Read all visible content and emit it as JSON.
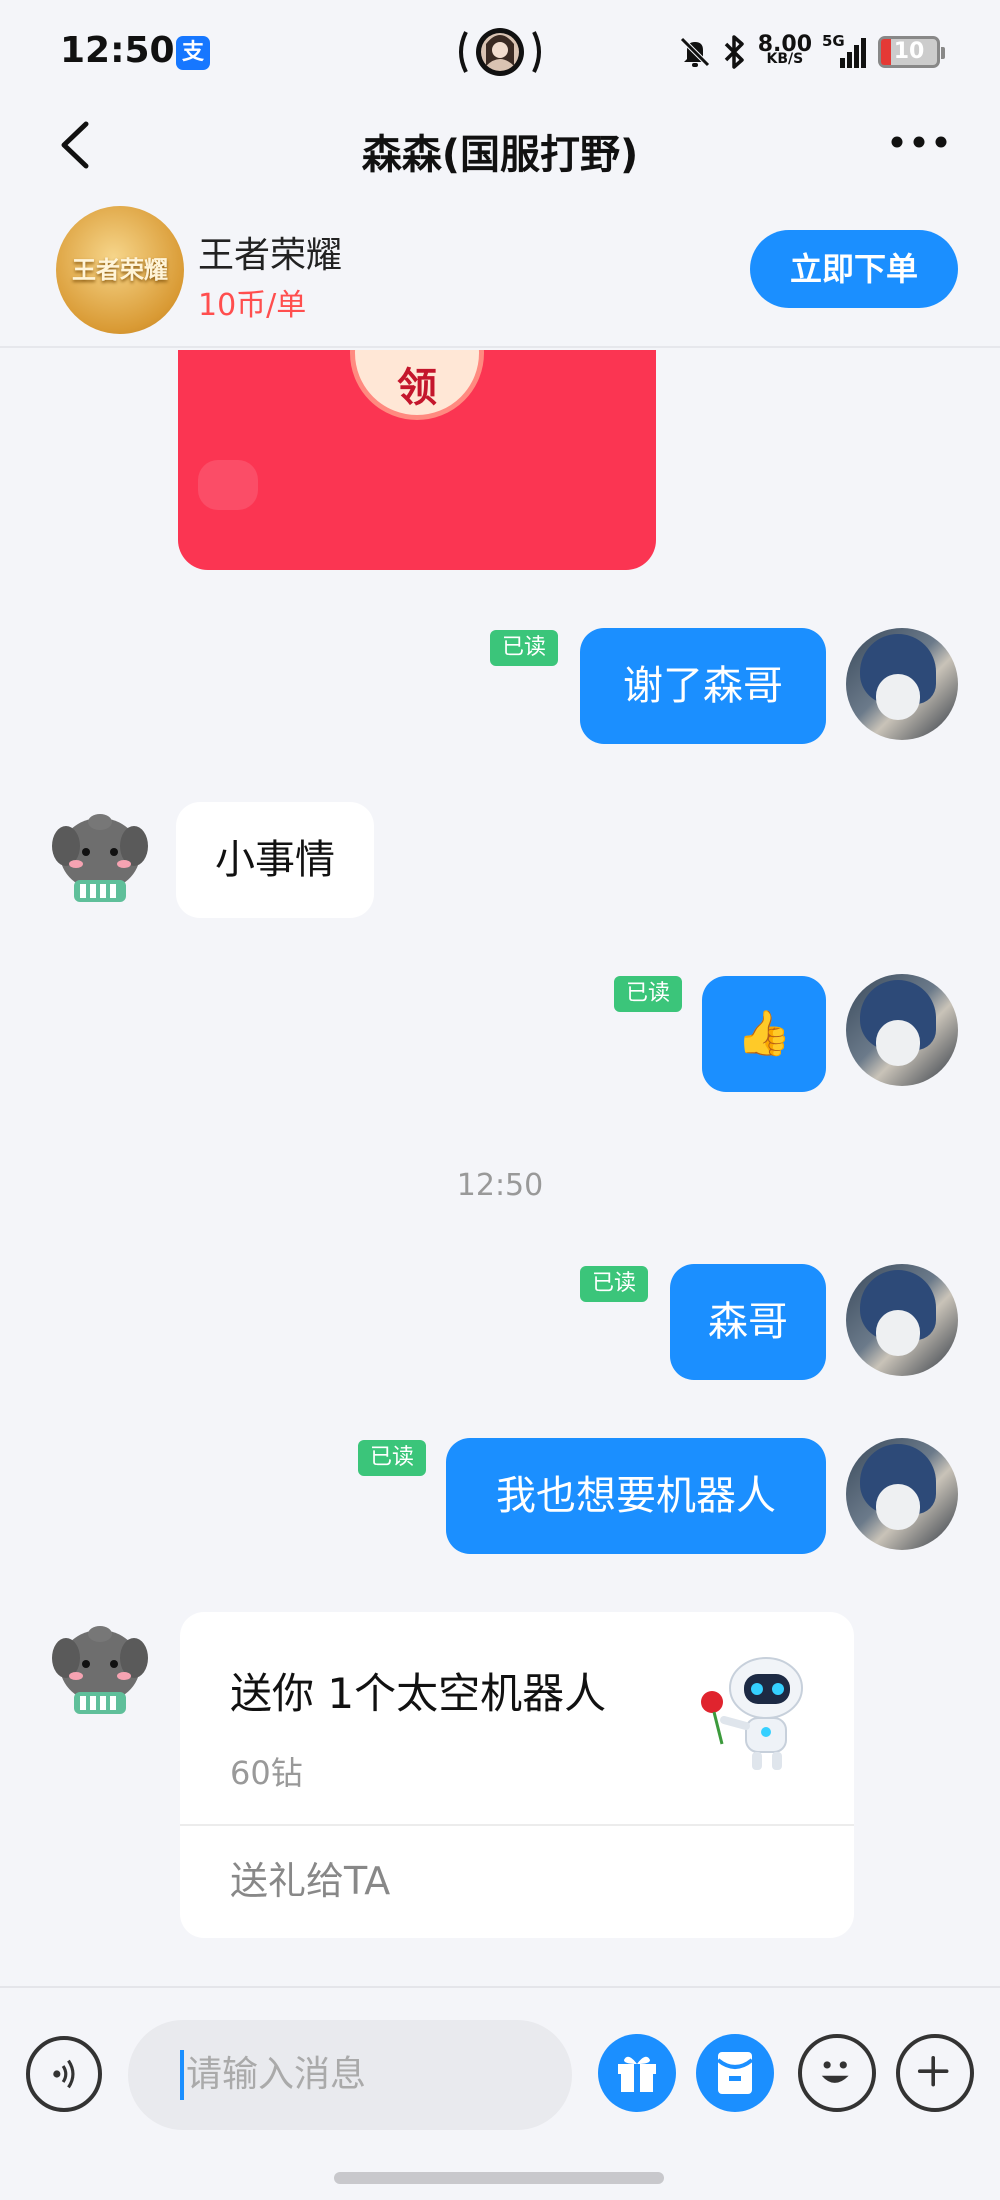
{
  "status_bar": {
    "time": "12:50",
    "alipay_icon": "支",
    "net_speed_value": "8.00",
    "net_speed_unit": "KB/S",
    "signal": "5G",
    "battery": "10",
    "icons": [
      "alipay-icon",
      "live-avatar-icon",
      "mute-bell-icon",
      "bluetooth-icon",
      "signal-icon",
      "battery-icon"
    ]
  },
  "nav": {
    "title": "森森(国服打野)",
    "back_icon": "chevron-left-icon",
    "more_icon": "more-dots-icon"
  },
  "service": {
    "game_logo_text": "王者荣耀",
    "game_name": "王者荣耀",
    "price": "10币/单",
    "order_button": "立即下单"
  },
  "red_envelope": {
    "claim_char": "领"
  },
  "messages": [
    {
      "side": "out",
      "text": "谢了森哥",
      "read": "已读"
    },
    {
      "side": "in",
      "text": "小事情"
    },
    {
      "side": "out",
      "text": "👍",
      "read": "已读"
    },
    {
      "side": "out",
      "text": "森哥",
      "read": "已读"
    },
    {
      "side": "out",
      "text": "我也想要机器人",
      "read": "已读"
    }
  ],
  "timestamp": "12:50",
  "gift": {
    "title": "送你 1个太空机器人",
    "price": "60钻",
    "action": "送礼给TA"
  },
  "input_bar": {
    "placeholder": "请输入消息",
    "icons": [
      "voice-icon",
      "gift-icon",
      "red-packet-icon",
      "emoji-icon",
      "plus-icon"
    ]
  },
  "colors": {
    "accent": "#1b8fff",
    "read_tag": "#3bc57a",
    "price_red": "#ff4e4e",
    "red_envelope": "#fb3552",
    "background": "#f4f5f9"
  }
}
